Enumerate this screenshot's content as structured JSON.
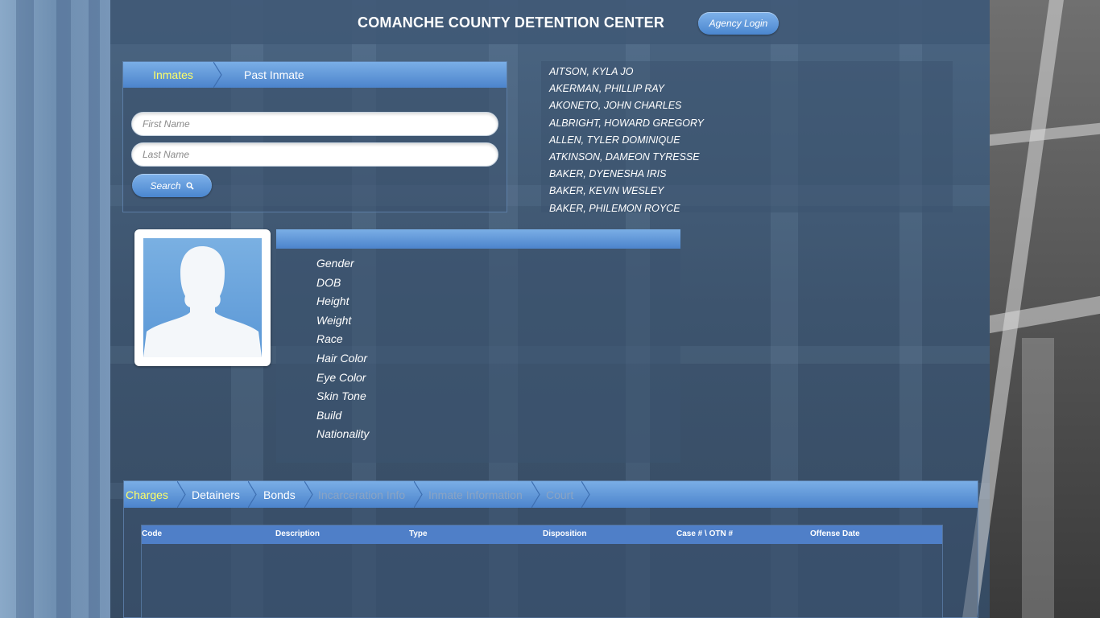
{
  "header": {
    "title": "COMANCHE COUNTY DETENTION CENTER",
    "agency_login": "Agency Login"
  },
  "search": {
    "tabs": [
      "Inmates",
      "Past Inmate"
    ],
    "first_name_placeholder": "First Name",
    "last_name_placeholder": "Last Name",
    "search_label": "Search"
  },
  "inmates": [
    "AITSON, KYLA JO",
    "AKERMAN, PHILLIP RAY",
    "AKONETO, JOHN CHARLES",
    "ALBRIGHT, HOWARD GREGORY",
    "ALLEN, TYLER DOMINIQUE",
    "ATKINSON, DAMEON TYRESSE",
    "BAKER, DYENESHA IRIS",
    "BAKER, KEVIN WESLEY",
    "BAKER, PHILEMON ROYCE"
  ],
  "details": {
    "fields": [
      "Gender",
      "DOB",
      "Height",
      "Weight",
      "Race",
      "Hair Color",
      "Eye Color",
      "Skin Tone",
      "Build",
      "Nationality"
    ]
  },
  "bottom_tabs": [
    "Charges",
    "Detainers",
    "Bonds",
    "Incarceration Info",
    "Inmate Information",
    "Court"
  ],
  "charges_table": {
    "columns": [
      "Code",
      "Description",
      "Type",
      "Disposition",
      "Case # \\ OTN #",
      "Offense Date"
    ]
  },
  "colors": {
    "accent_blue": "#4c84cc",
    "active_tab": "#ffff66"
  }
}
